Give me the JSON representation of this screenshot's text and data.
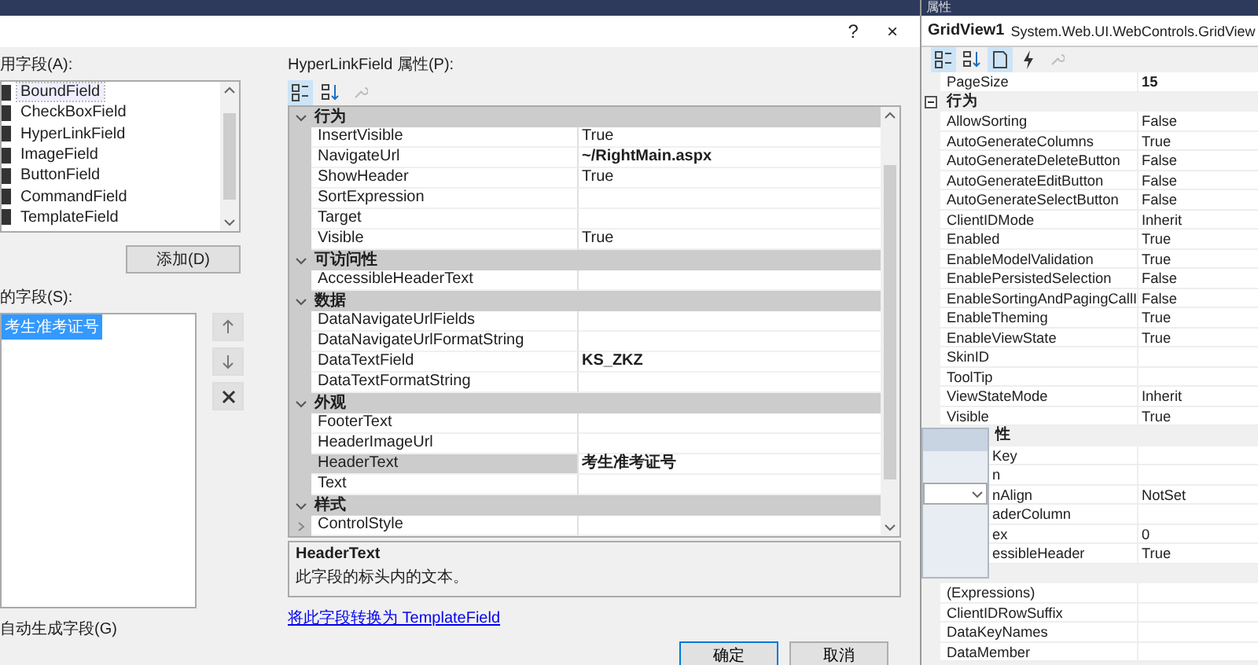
{
  "dialog": {
    "help": "?",
    "close": "×",
    "available_label": "用字段(A):",
    "available_fields": [
      {
        "label": "BoundField",
        "selected": true
      },
      {
        "label": "CheckBoxField",
        "selected": false
      },
      {
        "label": "HyperLinkField",
        "selected": false
      },
      {
        "label": "ImageField",
        "selected": false
      },
      {
        "label": "ButtonField",
        "selected": false
      },
      {
        "label": "CommandField",
        "selected": false
      },
      {
        "label": "TemplateField",
        "selected": false
      }
    ],
    "add_button": "添加(D)",
    "selected_label": "的字段(S):",
    "selected_fields": [
      {
        "label": "考生准考证号",
        "selected": true
      }
    ],
    "auto_generate": "自动生成字段(G)",
    "properties_label": "HyperLinkField 属性(P):",
    "properties": [
      {
        "kind": "category",
        "name": "行为"
      },
      {
        "kind": "prop",
        "name": "InsertVisible",
        "value": "True",
        "bold": false,
        "selected": false
      },
      {
        "kind": "prop",
        "name": "NavigateUrl",
        "value": "~/RightMain.aspx",
        "bold": true,
        "selected": false
      },
      {
        "kind": "prop",
        "name": "ShowHeader",
        "value": "True",
        "bold": false,
        "selected": false
      },
      {
        "kind": "prop",
        "name": "SortExpression",
        "selected": false
      },
      {
        "kind": "prop",
        "name": "Target",
        "selected": false
      },
      {
        "kind": "prop",
        "name": "Visible",
        "value": "True",
        "bold": false,
        "selected": false
      },
      {
        "kind": "category",
        "name": "可访问性"
      },
      {
        "kind": "prop",
        "name": "AccessibleHeaderText",
        "selected": false
      },
      {
        "kind": "category",
        "name": "数据"
      },
      {
        "kind": "prop",
        "name": "DataNavigateUrlFields",
        "selected": false
      },
      {
        "kind": "prop",
        "name": "DataNavigateUrlFormatString",
        "selected": false
      },
      {
        "kind": "prop",
        "name": "DataTextField",
        "value": "KS_ZKZ",
        "bold": true,
        "selected": false
      },
      {
        "kind": "prop",
        "name": "DataTextFormatString",
        "selected": false
      },
      {
        "kind": "category",
        "name": "外观"
      },
      {
        "kind": "prop",
        "name": "FooterText",
        "selected": false
      },
      {
        "kind": "prop",
        "name": "HeaderImageUrl",
        "selected": false
      },
      {
        "kind": "prop",
        "name": "HeaderText",
        "value": "考生准考证号",
        "bold": true,
        "selected": true
      },
      {
        "kind": "prop",
        "name": "Text",
        "selected": false
      },
      {
        "kind": "category",
        "name": "样式"
      },
      {
        "kind": "expandable",
        "name": "ControlStyle",
        "selected": false
      }
    ],
    "description_title": "HeaderText",
    "description_text": "此字段的标头内的文本。",
    "convert_link": "将此字段转换为 TemplateField",
    "buttons": [
      "确定",
      "取消"
    ]
  },
  "properties_pane": {
    "title": "属性",
    "object_name": "GridView1",
    "object_type": "System.Web.UI.WebControls.GridView",
    "rows": [
      {
        "kind": "prop",
        "name": "PageSize",
        "value": "15",
        "bold": true
      },
      {
        "kind": "category",
        "name": "行为"
      },
      {
        "kind": "prop",
        "name": "AllowSorting",
        "value": "False",
        "bold": false
      },
      {
        "kind": "prop",
        "name": "AutoGenerateColumns",
        "value": "True",
        "bold": false
      },
      {
        "kind": "prop",
        "name": "AutoGenerateDeleteButton",
        "value": "False",
        "bold": false
      },
      {
        "kind": "prop",
        "name": "AutoGenerateEditButton",
        "value": "False",
        "bold": false
      },
      {
        "kind": "prop",
        "name": "AutoGenerateSelectButton",
        "value": "False",
        "bold": false
      },
      {
        "kind": "prop",
        "name": "ClientIDMode",
        "value": "Inherit",
        "bold": false
      },
      {
        "kind": "prop",
        "name": "Enabled",
        "value": "True",
        "bold": false
      },
      {
        "kind": "prop",
        "name": "EnableModelValidation",
        "value": "True",
        "bold": false
      },
      {
        "kind": "prop",
        "name": "EnablePersistedSelection",
        "value": "False",
        "bold": false
      },
      {
        "kind": "prop",
        "name": "EnableSortingAndPagingCallI",
        "value": "False",
        "bold": false
      },
      {
        "kind": "prop",
        "name": "EnableTheming",
        "value": "True",
        "bold": false
      },
      {
        "kind": "prop",
        "name": "EnableViewState",
        "value": "True",
        "bold": false
      },
      {
        "kind": "prop",
        "name": "SkinID"
      },
      {
        "kind": "prop",
        "name": "ToolTip"
      },
      {
        "kind": "prop",
        "name": "ViewStateMode",
        "value": "Inherit",
        "bold": false
      },
      {
        "kind": "prop",
        "name": "Visible",
        "value": "True",
        "bold": false
      },
      {
        "kind": "covered_category",
        "name": "性"
      },
      {
        "kind": "covered",
        "name": "Key"
      },
      {
        "kind": "covered",
        "name": "n"
      },
      {
        "kind": "covered",
        "name": "nAlign",
        "value": "NotSet",
        "bold": false
      },
      {
        "kind": "covered",
        "name": "aderColumn"
      },
      {
        "kind": "covered",
        "name": "ex",
        "value": "0",
        "bold": false
      },
      {
        "kind": "covered",
        "name": "essibleHeader",
        "value": "True",
        "bold": false
      },
      {
        "kind": "covered_category"
      },
      {
        "kind": "prop",
        "name": "(Expressions)"
      },
      {
        "kind": "prop",
        "name": "ClientIDRowSuffix"
      },
      {
        "kind": "prop",
        "name": "DataKeyNames"
      },
      {
        "kind": "prop",
        "name": "DataMember"
      }
    ]
  }
}
